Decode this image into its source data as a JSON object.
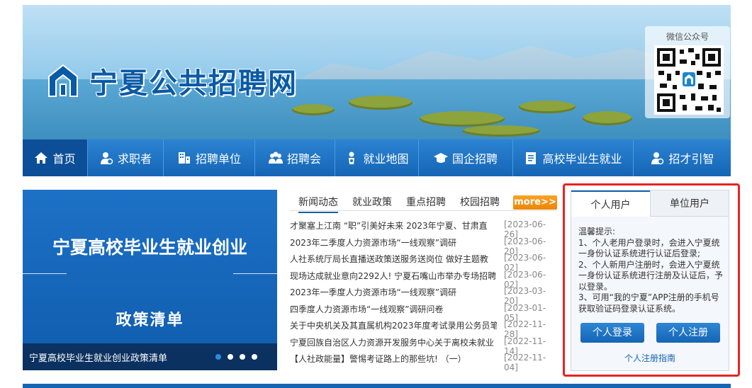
{
  "site": {
    "title": "宁夏公共招聘网",
    "qr_caption": "微信公众号"
  },
  "nav": {
    "items": [
      {
        "label": "首页",
        "icon": "home-icon",
        "active": true
      },
      {
        "label": "求职者",
        "icon": "user-icon"
      },
      {
        "label": "招聘单位",
        "icon": "building-icon"
      },
      {
        "label": "招聘会",
        "icon": "group-icon"
      },
      {
        "label": "就业地图",
        "icon": "map-icon"
      },
      {
        "label": "国企招聘",
        "icon": "graduation-cap-icon"
      },
      {
        "label": "高校毕业生就业",
        "icon": "document-icon"
      },
      {
        "label": "招才引智",
        "icon": "talent-icon"
      }
    ]
  },
  "slider": {
    "title": "宁夏高校毕业生就业创业",
    "subtitle": "政策清单",
    "caption": "宁夏高校毕业生就业创业政策清单",
    "dots": 4,
    "active_dot": 1
  },
  "news": {
    "tabs": [
      "新闻动态",
      "就业政策",
      "重点招聘",
      "校园招聘"
    ],
    "more_label": "more>>",
    "items": [
      {
        "title": "才聚塞上江南 “职”引美好未来 2023年宁夏、甘肃直",
        "date": "[2023-06-26]"
      },
      {
        "title": "2023年二季度人力资源市场“一线观察”调研",
        "date": "[2023-06-20]"
      },
      {
        "title": "人社系统厅局长直播送政策送服务送岗位 做好主题教",
        "date": "[2023-06-02]"
      },
      {
        "title": "现场达成就业意向2292人! 宁夏石嘴山市举办专场招聘",
        "date": "[2023-06-02]"
      },
      {
        "title": "2023年一季度人力资源市场“一线观察”调研",
        "date": "[2023-03-20]"
      },
      {
        "title": "四季度人力资源市场“一线观察”调研问卷",
        "date": "[2023-01-05]"
      },
      {
        "title": "关于中央机关及其直属机构2023年度考试录用公务员笔",
        "date": "[2022-11-28]"
      },
      {
        "title": "宁夏回族自治区人力资源开发服务中心关于离校未就业",
        "date": "[2022-11-14]"
      },
      {
        "title": "【人社政能量】警惕考证路上的那些坑! （一）",
        "date": "[2022-11-04]"
      }
    ]
  },
  "login": {
    "tabs": [
      "个人用户",
      "单位用户"
    ],
    "tip_lines": [
      "温馨提示:",
      "1、个人老用户登录时，会进入宁夏统一身份认证系统进行认证后登录;",
      "2、个人新用户注册时，会进入宁夏统一身份认证系统进行注册及认证后，予以登录。",
      "3、可用“我的宁夏”APP注册的手机号获取验证码登录认证系统。"
    ],
    "login_button": "个人登录",
    "register_button": "个人注册",
    "guide_link": "个人注册指南"
  },
  "colors": {
    "primary": "#1565b5",
    "nav_active": "#0c4f98",
    "more_orange": "#f39316",
    "highlight_red": "#e52424"
  }
}
